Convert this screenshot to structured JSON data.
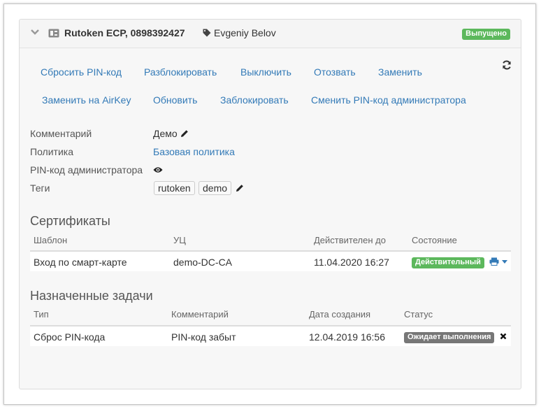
{
  "token": {
    "name": "Rutoken ECP, 0898392427",
    "owner": "Evgeniy Belov",
    "status_badge": "Выпущено"
  },
  "actions": {
    "row1": [
      "Сбросить PIN-код",
      "Разблокировать",
      "Выключить",
      "Отозвать",
      "Заменить"
    ],
    "row2": [
      "Заменить на AirKey",
      "Обновить",
      "Заблокировать",
      "Сменить PIN-код администратора"
    ]
  },
  "details": {
    "comment_label": "Комментарий",
    "comment_value": "Демо",
    "policy_label": "Политика",
    "policy_value": "Базовая политика",
    "admin_pin_label": "PIN-код администратора",
    "tags_label": "Теги",
    "tags": [
      "rutoken",
      "demo"
    ]
  },
  "certificates": {
    "title": "Сертификаты",
    "columns": [
      "Шаблон",
      "УЦ",
      "Действителен до",
      "Состояние"
    ],
    "rows": [
      {
        "template": "Вход по смарт-карте",
        "ca": "demo-DC-CA",
        "valid_until": "11.04.2020 16:27",
        "state": "Действительный"
      }
    ]
  },
  "tasks": {
    "title": "Назначенные задачи",
    "columns": [
      "Тип",
      "Комментарий",
      "Дата создания",
      "Статус"
    ],
    "rows": [
      {
        "type": "Сброс PIN-кода",
        "comment": "PIN-код забыт",
        "created": "12.04.2019 16:56",
        "status": "Ожидает выполнения"
      }
    ]
  },
  "colors": {
    "link": "#337ab7",
    "success": "#5cb85c",
    "waiting": "#777777"
  }
}
